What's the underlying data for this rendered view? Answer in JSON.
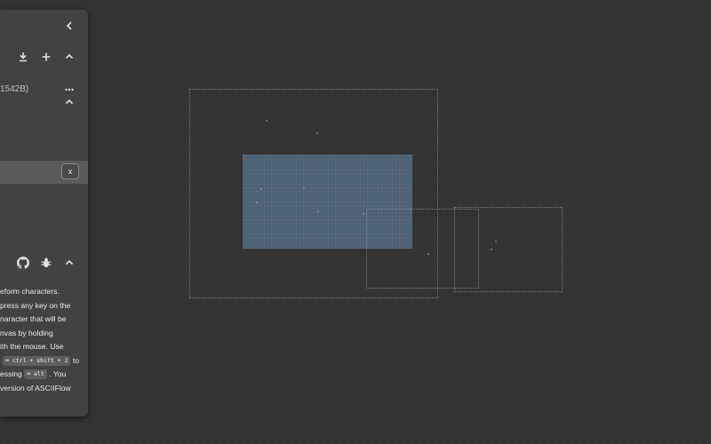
{
  "sidebar": {
    "file": {
      "label": "1542B)"
    },
    "help": {
      "lines": [
        "eform characters.",
        "press any key on the",
        "naracter that will be",
        "nvas by holding",
        "ith the mouse. Use",
        "to",
        "essing",
        ". You",
        "version of ASCIIFlow"
      ],
      "kbd_shortcut": "⌨ ctrl + shift + 2",
      "kbd_alt": "⌨ alt"
    },
    "selected_row": {
      "close_label": "x"
    }
  },
  "icons": {
    "collapse": "chevron-left-icon",
    "download": "download-icon",
    "add": "plus-icon",
    "more": "more-horizontal-icon",
    "github": "github-icon",
    "bug": "bug-icon"
  },
  "colors": {
    "background": "#333333",
    "sidebar": "#424242",
    "selection": "#5f87aa"
  }
}
